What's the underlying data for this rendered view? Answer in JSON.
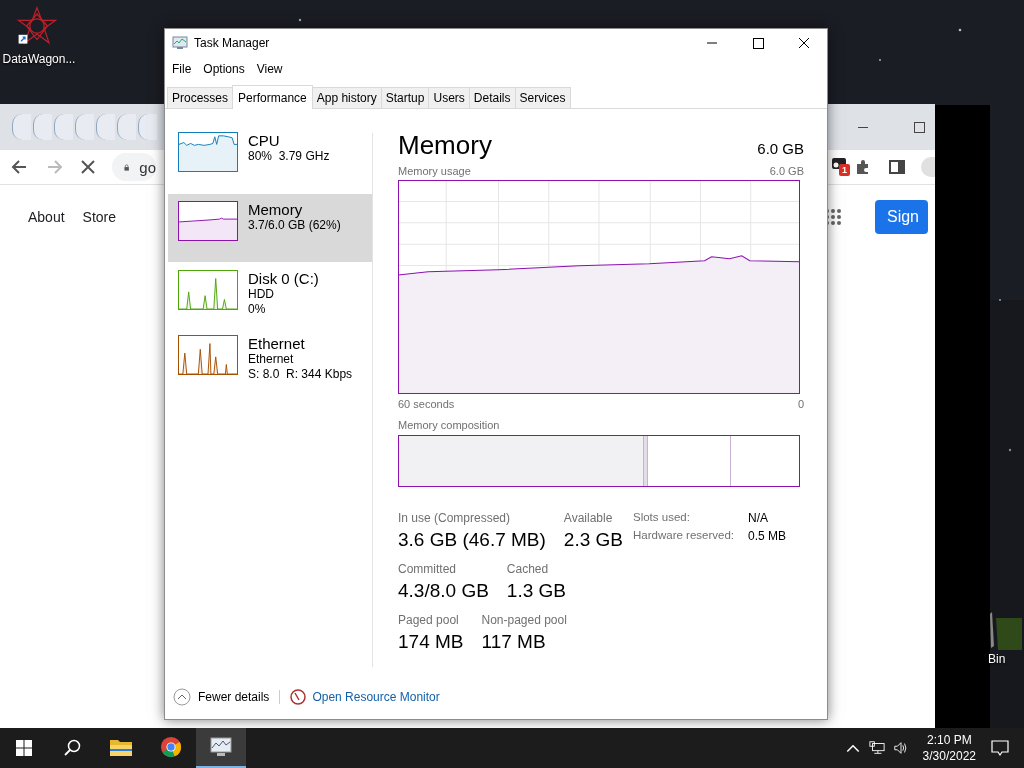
{
  "desktop": {
    "icons": [
      {
        "label": "DataWagon...",
        "kind": "app"
      },
      {
        "label": "Bin",
        "kind": "bin"
      }
    ]
  },
  "browser": {
    "address": "go",
    "extension_badge": "1",
    "nav_links": [
      "About",
      "Store"
    ],
    "sign_in_button": "Sign"
  },
  "task_manager": {
    "title": "Task Manager",
    "menu": [
      "File",
      "Options",
      "View"
    ],
    "tabs": [
      {
        "label": "Processes",
        "selected": false
      },
      {
        "label": "Performance",
        "selected": true
      },
      {
        "label": "App history",
        "selected": false
      },
      {
        "label": "Startup",
        "selected": false
      },
      {
        "label": "Users",
        "selected": false
      },
      {
        "label": "Details",
        "selected": false
      },
      {
        "label": "Services",
        "selected": false
      }
    ],
    "resources": [
      {
        "name": "CPU",
        "lines": [
          "80%  3.79 GHz"
        ],
        "color": "#117dbb",
        "selected": false
      },
      {
        "name": "Memory",
        "lines": [
          "3.7/6.0 GB (62%)"
        ],
        "color": "#8b12ae",
        "selected": true
      },
      {
        "name": "Disk 0 (C:)",
        "lines": [
          "HDD",
          "0%"
        ],
        "color": "#4da60c",
        "selected": false
      },
      {
        "name": "Ethernet",
        "lines": [
          "Ethernet",
          "S: 8.0  R: 344 Kbps"
        ],
        "color": "#a74f01",
        "selected": false
      }
    ],
    "detail": {
      "title": "Memory",
      "total": "6.0 GB",
      "graph_label": "Memory usage",
      "graph_max": "6.0 GB",
      "time_start": "60 seconds",
      "time_end": "0",
      "composition_label": "Memory composition",
      "stats": [
        [
          {
            "label": "In use (Compressed)",
            "value": "3.6 GB (46.7 MB)"
          },
          {
            "label": "Available",
            "value": "2.3 GB"
          }
        ],
        [
          {
            "label": "Committed",
            "value": "4.3/8.0 GB"
          },
          {
            "label": "Cached",
            "value": "1.3 GB"
          }
        ],
        [
          {
            "label": "Paged pool",
            "value": "174 MB"
          },
          {
            "label": "Non-paged pool",
            "value": "117 MB"
          }
        ]
      ],
      "side_stats": [
        {
          "label": "Slots used:",
          "value": "N/A"
        },
        {
          "label": "Hardware reserved:",
          "value": "0.5 MB"
        }
      ]
    },
    "footer": {
      "fewer_details": "Fewer details",
      "resource_monitor_link": "Open Resource Monitor"
    }
  },
  "taskbar": {
    "apps": [
      {
        "kind": "explorer",
        "active": false
      },
      {
        "kind": "chrome",
        "active": false
      },
      {
        "kind": "task-manager",
        "active": true
      }
    ],
    "clock": {
      "time": "2:10 PM",
      "date": "3/30/2022"
    }
  }
}
